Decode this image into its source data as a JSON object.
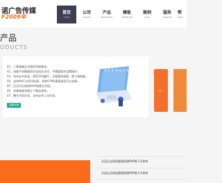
{
  "header": {
    "logo_title": "诺广告传媒",
    "logo_sub": "F2009年"
  },
  "nav": [
    {
      "cn": "首页",
      "en": "HOME",
      "active": true
    },
    {
      "cn": "公司",
      "en": "NOTICE",
      "active": false
    },
    {
      "cn": "产品",
      "en": "PRODUCTS",
      "active": false
    },
    {
      "cn": "模板",
      "en": "TEMPLATE",
      "active": false
    },
    {
      "cn": "案例",
      "en": "CASE",
      "active": false
    },
    {
      "cn": "服务",
      "en": "SERVICE",
      "active": false
    },
    {
      "cn": "帮",
      "en": "HELP",
      "active": false
    }
  ],
  "products": {
    "title": "产品",
    "subtitle": "ODUCTS",
    "features": [
      "01、三套精美后台随时切换使用。",
      "02、电脑手机数据同步自适应访问，不需要复杂设置维护。",
      "03、符合w3c标准，规范代码编写，天猫喜欢搜索，便于维智能。",
      "04、支持MVC对资讯处理，多种HTML模板类型可以选择。",
      "05、后台可以修改WAP前模式字段。",
      "06、完善地使用独立个数局规则。",
      "07、整生代码开发，支持文件二次开发。"
    ],
    "more_label": "查看详情",
    "banner_tag": "云 好 家 网 站 平 台"
  },
  "news": [
    "凡诺企业网站管理系统PHP版 5.0发布",
    "凡诺企业网站管理系统PHP版 4.0发布"
  ],
  "colors": {
    "accent": "#fa6c1a",
    "nav_active": "#3c3e54",
    "button": "#1aab8a",
    "illus_blue": "#6aa6e8"
  }
}
